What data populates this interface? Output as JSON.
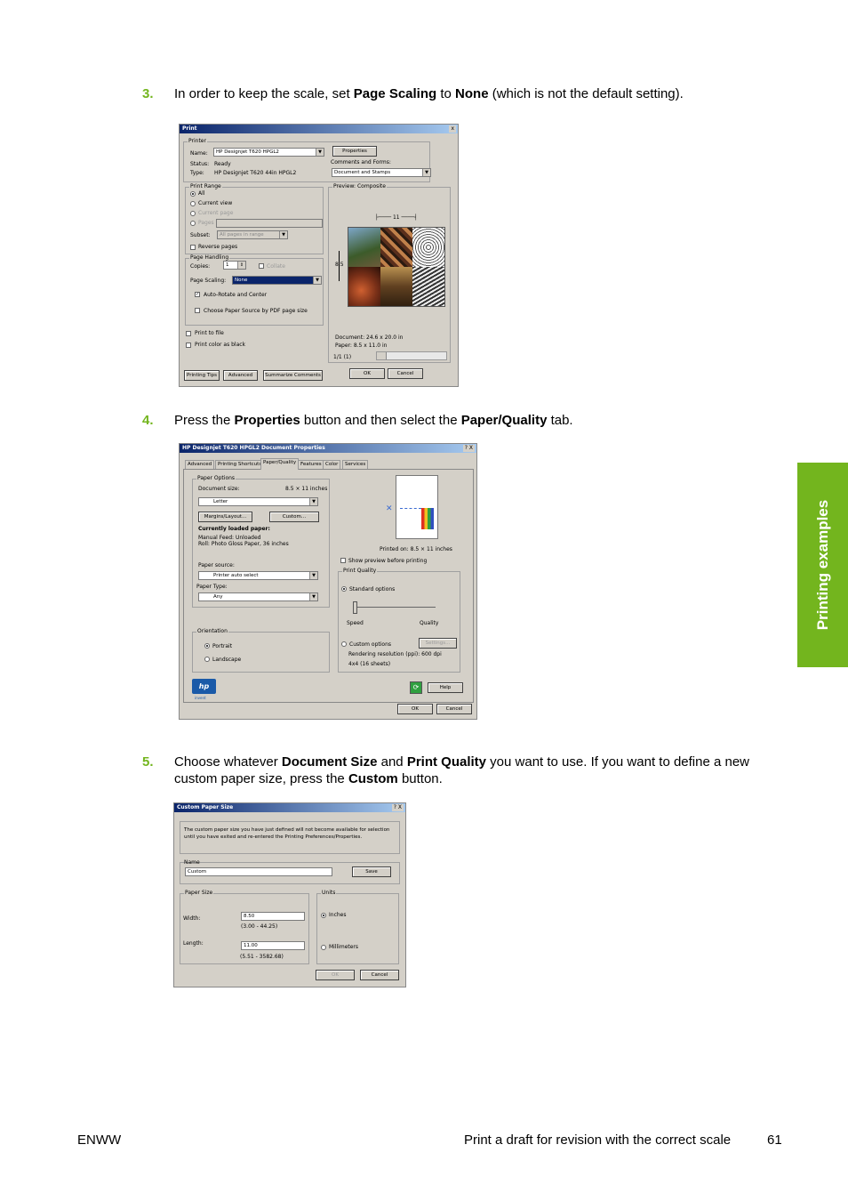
{
  "side_tab": "Printing examples",
  "steps": [
    {
      "num": "3.",
      "parts": [
        "In order to keep the scale, set ",
        "Page Scaling",
        " to ",
        "None",
        " (which is not the default setting)."
      ]
    },
    {
      "num": "4.",
      "parts": [
        "Press the ",
        "Properties",
        " button and then select the ",
        "Paper/Quality",
        " tab."
      ]
    },
    {
      "num": "5.",
      "parts": [
        "Choose whatever ",
        "Document Size",
        " and ",
        "Print Quality",
        " you want to use. If you want to define a new custom paper size, press the ",
        "Custom",
        " button."
      ]
    }
  ],
  "print_dialog": {
    "title": "Print",
    "close": "x",
    "printer_group": "Printer",
    "name_label": "Name:",
    "name_value": "HP Designjet T620       HPGL2",
    "properties_button": "Properties",
    "status_label": "Status:",
    "status_value": "Ready",
    "type_label": "Type:",
    "type_value": "HP Designjet T620 44in HPGL2",
    "comments_label": "Comments and Forms:",
    "comments_value": "Document and Stamps",
    "range_group": "Print Range",
    "all": "All",
    "current_view": "Current view",
    "current_page": "Current page",
    "pages": "Pages",
    "subset_label": "Subset:",
    "subset_value": "All pages in range",
    "reverse": "Reverse pages",
    "handling_group": "Page Handling",
    "copies_label": "Copies:",
    "copies_value": "1",
    "collate": "Collate",
    "scaling_label": "Page Scaling:",
    "scaling_value": "None",
    "autorotate": "Auto-Rotate and Center",
    "paper_source": "Choose Paper Source by PDF page size",
    "print_to_file": "Print to file",
    "print_color": "Print color as black",
    "preview_group": "Preview: Composite",
    "width_dim": "11",
    "height_dim": "8.5",
    "doc_size": "Document: 24.6 x 20.0 in",
    "paper_size": "Paper: 8.5 x 11.0 in",
    "page_count": "1/1 (1)",
    "printing_tips": "Printing Tips",
    "advanced": "Advanced",
    "summarize": "Summarize Comments",
    "ok": "OK",
    "cancel": "Cancel"
  },
  "props_dialog": {
    "title": "HP Designjet T620          HPGL2 Document Properties",
    "title_buttons": "? X",
    "tabs": [
      "Advanced",
      "Printing Shortcuts",
      "Paper/Quality",
      "Features",
      "Color",
      "Services"
    ],
    "paper_options": "Paper Options",
    "doc_size_label": "Document size:",
    "doc_size_value": "8.5 × 11 inches",
    "size_select": "Letter",
    "margins": "Margins/Layout...",
    "custom": "Custom...",
    "loaded_label": "Currently loaded paper:",
    "loaded_line1": "Manual Feed: Unloaded",
    "loaded_line2": "Roll:  Photo Gloss Paper, 36 inches",
    "source_label": "Paper source:",
    "source_value": "Printer auto select",
    "type_label": "Paper Type:",
    "type_value": "Any",
    "orientation": "Orientation",
    "portrait": "Portrait",
    "landscape": "Landscape",
    "printed_on": "Printed on: 8.5 × 11 inches",
    "show_preview": "Show preview before printing",
    "print_quality": "Print Quality",
    "standard": "Standard options",
    "speed": "Speed",
    "quality": "Quality",
    "custom_options": "Custom options",
    "settings": "Settings...",
    "resolution": "Rendering resolution (ppi): 600 dpi",
    "sheets": "4x4 (16 sheets)",
    "logo": "hp",
    "logo_sub": "invent",
    "help": "Help",
    "ok": "OK",
    "cancel": "Cancel"
  },
  "custom_dialog": {
    "title": "Custom Paper Size",
    "title_buttons": "? X",
    "note": "The custom paper size you have just defined will not become available for selection until you have exited and re-entered the Printing Preferences/Properties.",
    "name_label": "Name",
    "name_value": "Custom",
    "save": "Save",
    "paper_size_group": "Paper Size",
    "width_label": "Width:",
    "width_value": "8.50",
    "width_range": "(3.00 - 44.25)",
    "length_label": "Length:",
    "length_value": "11.00",
    "length_range": "(5.51 - 3582.68)",
    "units_group": "Units",
    "inches": "Inches",
    "millimeters": "Millimeters",
    "ok": "OK",
    "cancel": "Cancel"
  },
  "footer": {
    "left": "ENWW",
    "title": "Print a draft for revision with the correct scale",
    "page": "61"
  }
}
